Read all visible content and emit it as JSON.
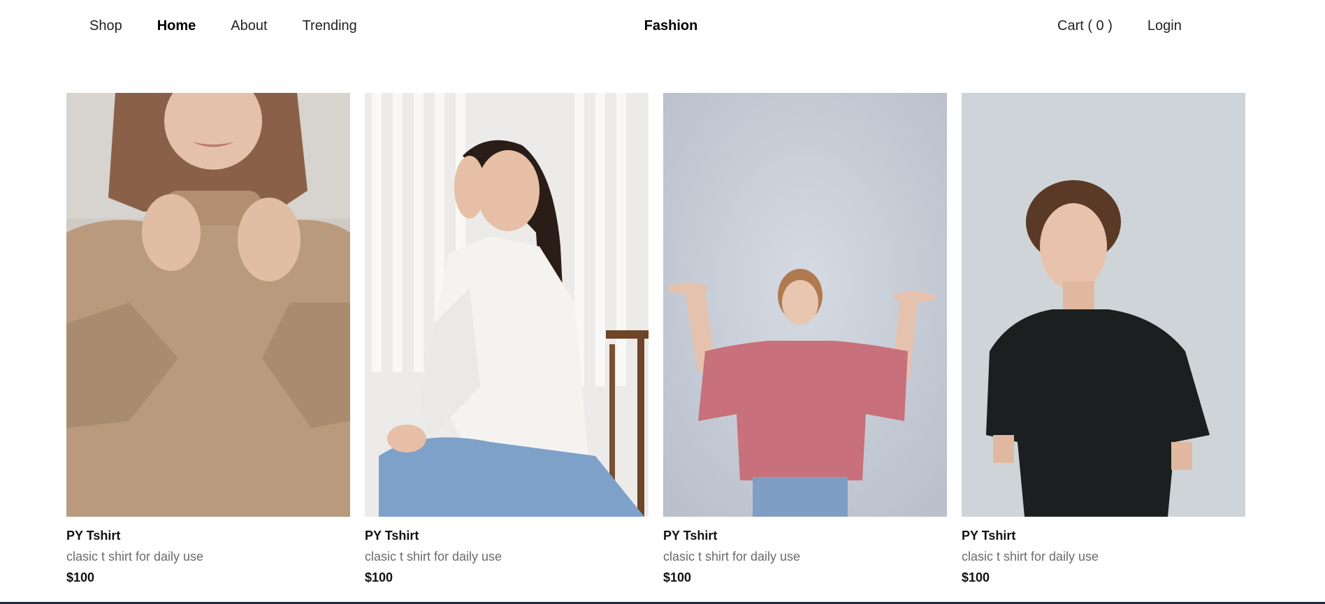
{
  "nav": {
    "left": [
      {
        "label": "Shop",
        "active": false
      },
      {
        "label": "Home",
        "active": true
      },
      {
        "label": "About",
        "active": false
      },
      {
        "label": "Trending",
        "active": false
      }
    ],
    "brand": "Fashion",
    "cart_label": "Cart ( 0 )",
    "login_label": "Login"
  },
  "products": [
    {
      "title": "PY Tshirt",
      "description": "clasic t shirt for daily use",
      "price": "$100"
    },
    {
      "title": "PY Tshirt",
      "description": "clasic t shirt for daily use",
      "price": "$100"
    },
    {
      "title": "PY Tshirt",
      "description": "clasic t shirt for daily use",
      "price": "$100"
    },
    {
      "title": "PY Tshirt",
      "description": "clasic t shirt for daily use",
      "price": "$100"
    }
  ],
  "colors": {
    "text": "#111111",
    "muted": "#6b6b6b",
    "bottom_bar": "#1c2a3a"
  }
}
